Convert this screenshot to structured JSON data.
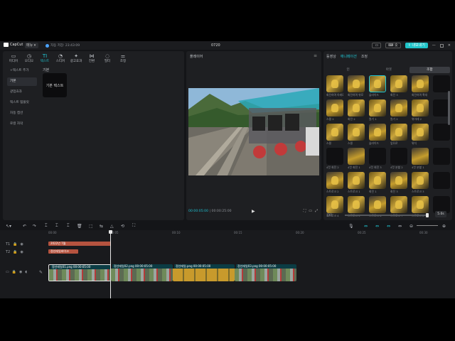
{
  "app": {
    "logo": "CapCut",
    "menu_label": "메뉴",
    "autosave": "자동 저장: 23:43:09",
    "title": "0720",
    "btn_1": "숏",
    "share_label": "내보내기"
  },
  "media_panel": {
    "tools": [
      {
        "label": "미디어",
        "icon": "media-icon",
        "glyph": "▭"
      },
      {
        "label": "오디오",
        "icon": "audio-icon",
        "glyph": "◷"
      },
      {
        "label": "텍스트",
        "icon": "text-icon",
        "glyph": "TI"
      },
      {
        "label": "스티커",
        "icon": "sticker-icon",
        "glyph": "◔"
      },
      {
        "label": "광고효과",
        "icon": "effect-icon",
        "glyph": "✦"
      },
      {
        "label": "전환",
        "icon": "transition-icon",
        "glyph": "⋈"
      },
      {
        "label": "필터",
        "icon": "filter-icon",
        "glyph": "◌"
      },
      {
        "label": "조정",
        "icon": "adjust-icon",
        "glyph": "⚌"
      }
    ],
    "nav": [
      {
        "label": "+텍스트 추가"
      },
      {
        "label": "기본"
      },
      {
        "label": "광업효과"
      },
      {
        "label": "텍스트 템플릿"
      },
      {
        "label": "자동 캡션"
      },
      {
        "label": "로컬 자막"
      }
    ],
    "section_title": "기본",
    "card_text": "기본 텍스트"
  },
  "player": {
    "title": "플레이어",
    "current_time": "00:00:05:00",
    "total_time": "00:00:25:00"
  },
  "props_panel": {
    "tabs": [
      "동영상",
      "애니메이션",
      "조정"
    ],
    "subtabs": [
      "인",
      "아웃",
      "조합"
    ],
    "animations": [
      {
        "label": "회전하며 아래로"
      },
      {
        "label": "회전하며 위로"
      },
      {
        "label": "슬라이드"
      },
      {
        "label": "회전 3"
      },
      {
        "label": "회전하며 확대"
      },
      {
        "label": ""
      },
      {
        "label": "스윙 2"
      },
      {
        "label": "회전 2"
      },
      {
        "label": "원기 1"
      },
      {
        "label": "원기 2"
      },
      {
        "label": "위아래 2"
      },
      {
        "label": ""
      },
      {
        "label": "스윙"
      },
      {
        "label": "스윙"
      },
      {
        "label": "슬라이드"
      },
      {
        "label": "앞뒤로"
      },
      {
        "label": "위치"
      },
      {
        "label": ""
      },
      {
        "label": "4컷 회전 2"
      },
      {
        "label": "4컷 회전 1"
      },
      {
        "label": "4컷 회전 3"
      },
      {
        "label": "4컷 분할 2"
      },
      {
        "label": "4컷 분할 1"
      },
      {
        "label": ""
      },
      {
        "label": "스트로크 2"
      },
      {
        "label": "스트로크 1"
      },
      {
        "label": "회전 1"
      },
      {
        "label": "회전 3"
      },
      {
        "label": "스트로크 3"
      },
      {
        "label": ""
      },
      {
        "label": "스트로크 4"
      },
      {
        "label": "스트로크 5"
      },
      {
        "label": "스트로크 6"
      },
      {
        "label": "스트로크 7"
      },
      {
        "label": "스트로크 8"
      },
      {
        "label": ""
      }
    ],
    "duration_label": "길이",
    "duration_value": "5.0s"
  },
  "timeline": {
    "ruler": [
      "00:00",
      "00:05",
      "00:10",
      "00:15",
      "00:20",
      "00:25",
      "00:30"
    ],
    "text_clip_1": "2022년 7월",
    "text_clip_2": "정선레일바이크",
    "video_clips": [
      {
        "label": "정선레일01.png 00:00:05:00"
      },
      {
        "label": "정선레일02.png 00:00:05:00"
      },
      {
        "label": "정선레일.png 00:00:05:00"
      },
      {
        "label": "정선레일03.png 00:00:05:00"
      }
    ]
  },
  "colors": {
    "accent": "#20c7d4",
    "text_clip": "#b5533f",
    "video_clip_header": "#1e6f73"
  }
}
